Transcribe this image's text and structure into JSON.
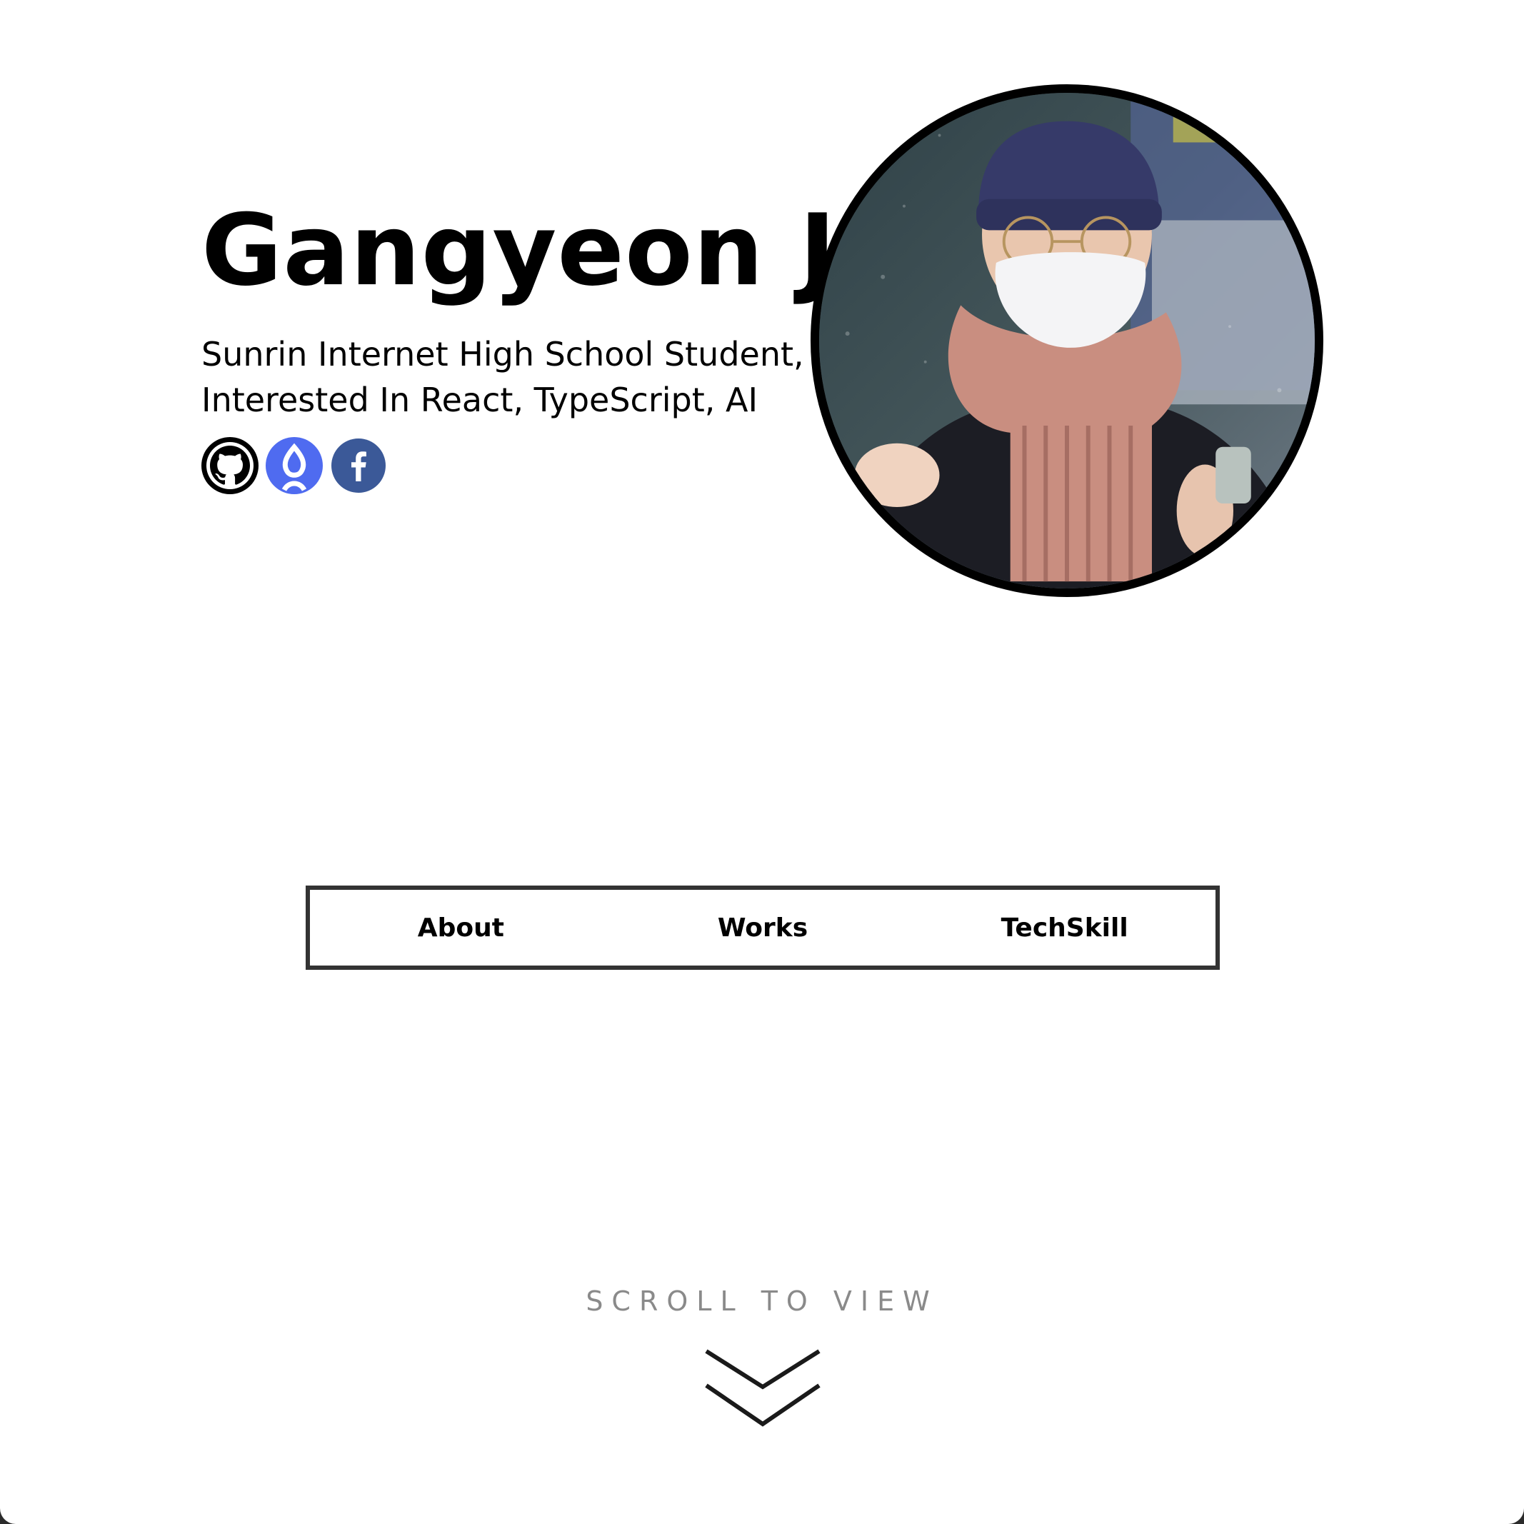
{
  "profile": {
    "name": "Gangyeon Jo",
    "subtitle_line1": "Sunrin Internet High School Student,",
    "subtitle_line2": "Interested In React, TypeScript, AI"
  },
  "social": [
    {
      "icon": "github-icon",
      "color": "#000000"
    },
    {
      "icon": "velog-icon",
      "color": "#4f6bf0"
    },
    {
      "icon": "facebook-icon",
      "color": "#3b5998"
    }
  ],
  "nav": {
    "items": [
      "About",
      "Works",
      "TechSkill"
    ]
  },
  "scroll_hint": {
    "label": "SCROLL TO VIEW",
    "icon": "double-chevron-down-icon"
  }
}
